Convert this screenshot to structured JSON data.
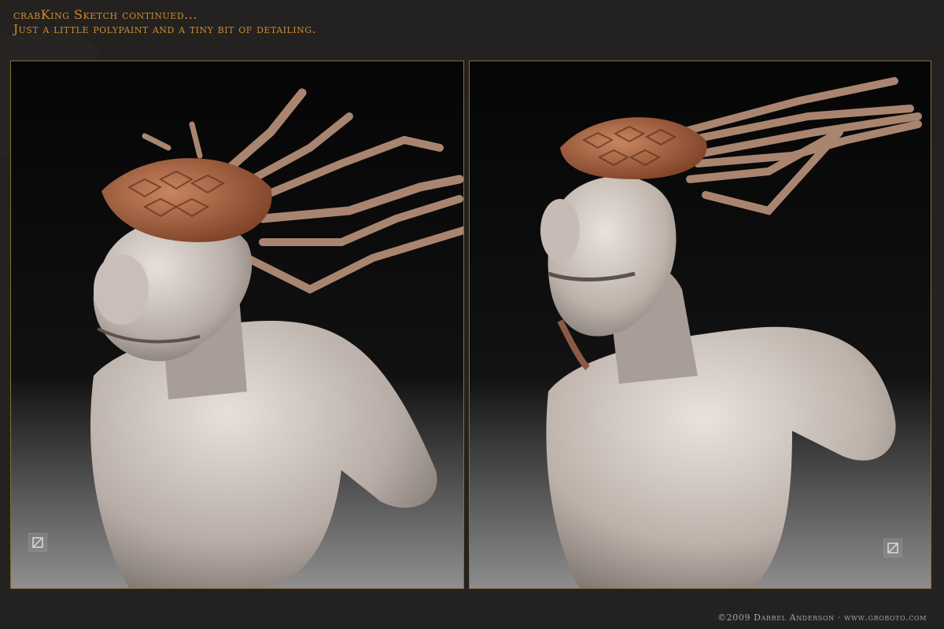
{
  "header": {
    "title": "crabKing Sketch continued...",
    "subtitle": "Just a little polypaint and a tiny bit of detailing."
  },
  "footer": {
    "credit": "©2009 Darrel Anderson · www.groboto.com"
  },
  "panels": [
    {
      "view": "three-quarter",
      "badge_icon": "sculpt-logo-icon"
    },
    {
      "view": "front-three-quarter",
      "badge_icon": "sculpt-logo-icon"
    }
  ],
  "colors": {
    "background": "#232221",
    "header_text": "#d18a2c",
    "panel_border": "#8a6a3f",
    "skin": "#cfc7c0",
    "crab_shell": "#b06a45",
    "footer_text": "#a6a6a6"
  }
}
